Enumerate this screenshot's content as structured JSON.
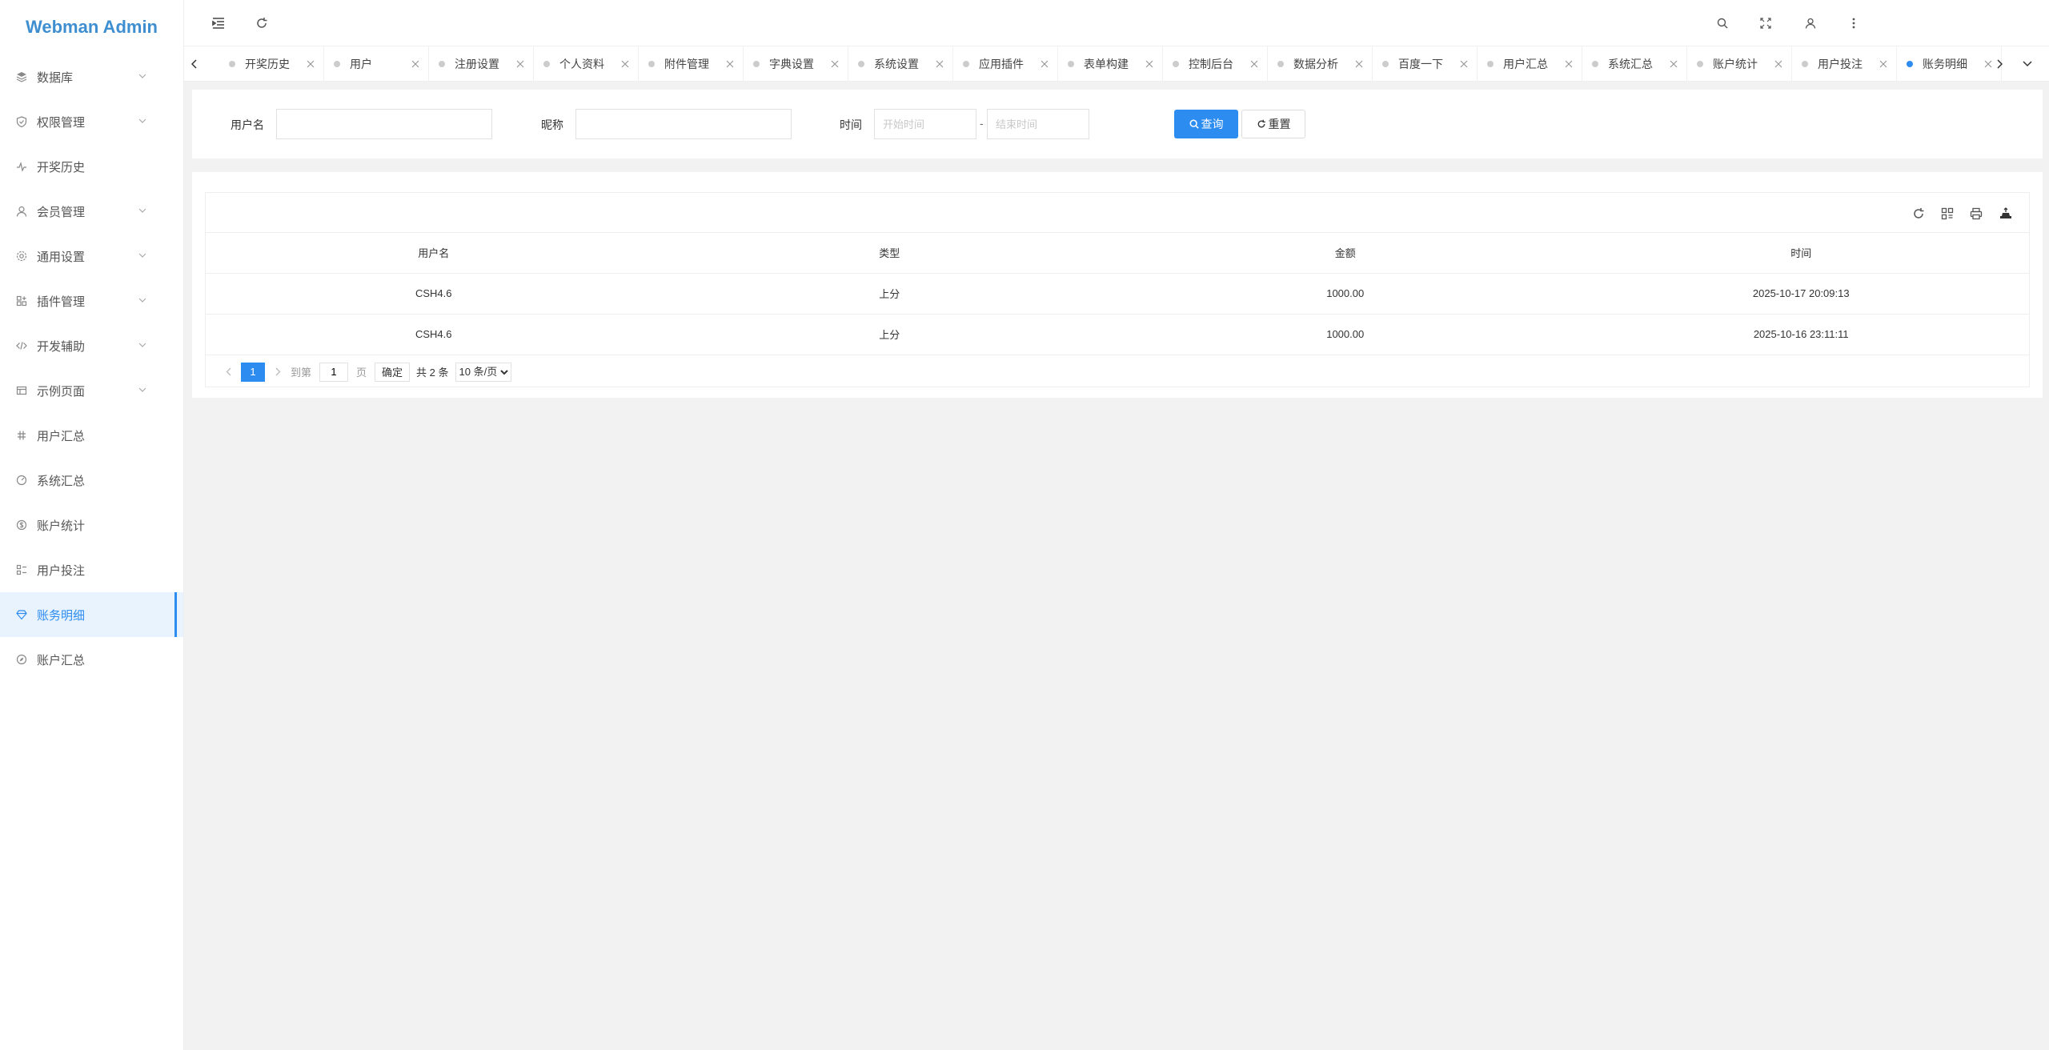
{
  "app": {
    "title": "Webman Admin"
  },
  "sidebar": {
    "items": [
      {
        "label": "数据库",
        "icon": "layers-icon",
        "has_children": true,
        "active": false
      },
      {
        "label": "权限管理",
        "icon": "shield-icon",
        "has_children": true,
        "active": false
      },
      {
        "label": "开奖历史",
        "icon": "pulse-icon",
        "has_children": false,
        "active": false
      },
      {
        "label": "会员管理",
        "icon": "user-icon",
        "has_children": true,
        "active": false
      },
      {
        "label": "通用设置",
        "icon": "gear-icon",
        "has_children": true,
        "active": false
      },
      {
        "label": "插件管理",
        "icon": "plugin-icon",
        "has_children": true,
        "active": false
      },
      {
        "label": "开发辅助",
        "icon": "code-icon",
        "has_children": true,
        "active": false
      },
      {
        "label": "示例页面",
        "icon": "template-icon",
        "has_children": true,
        "active": false
      },
      {
        "label": "用户汇总",
        "icon": "link-icon",
        "has_children": false,
        "active": false
      },
      {
        "label": "系统汇总",
        "icon": "dashboard-icon",
        "has_children": false,
        "active": false
      },
      {
        "label": "账户统计",
        "icon": "dollar-icon",
        "has_children": false,
        "active": false
      },
      {
        "label": "用户投注",
        "icon": "form-icon",
        "has_children": false,
        "active": false
      },
      {
        "label": "账务明细",
        "icon": "diamond-icon",
        "has_children": false,
        "active": true
      },
      {
        "label": "账户汇总",
        "icon": "compass-icon",
        "has_children": false,
        "active": false
      }
    ]
  },
  "tabs": [
    {
      "label": "开奖历史",
      "active": false
    },
    {
      "label": "用户",
      "active": false
    },
    {
      "label": "注册设置",
      "active": false
    },
    {
      "label": "个人资料",
      "active": false
    },
    {
      "label": "附件管理",
      "active": false
    },
    {
      "label": "字典设置",
      "active": false
    },
    {
      "label": "系统设置",
      "active": false
    },
    {
      "label": "应用插件",
      "active": false
    },
    {
      "label": "表单构建",
      "active": false
    },
    {
      "label": "控制后台",
      "active": false
    },
    {
      "label": "数据分析",
      "active": false
    },
    {
      "label": "百度一下",
      "active": false
    },
    {
      "label": "用户汇总",
      "active": false
    },
    {
      "label": "系统汇总",
      "active": false
    },
    {
      "label": "账户统计",
      "active": false
    },
    {
      "label": "用户投注",
      "active": false
    },
    {
      "label": "账务明细",
      "active": true
    }
  ],
  "search": {
    "username_label": "用户名",
    "username_value": "",
    "nickname_label": "昵称",
    "nickname_value": "",
    "time_label": "时间",
    "start_placeholder": "开始时间",
    "end_placeholder": "结束时间",
    "separator": "-",
    "query_label": "查询",
    "reset_label": "重置"
  },
  "table": {
    "columns": [
      "用户名",
      "类型",
      "金额",
      "时间"
    ],
    "rows": [
      [
        "CSH4.6",
        "上分",
        "1000.00",
        "2025-10-17 20:09:13"
      ],
      [
        "CSH4.6",
        "上分",
        "1000.00",
        "2025-10-16 23:11:11"
      ]
    ]
  },
  "pagination": {
    "current_page": "1",
    "goto_label": "到第",
    "goto_value": "1",
    "page_unit": "页",
    "confirm_label": "确定",
    "total_text": "共 2 条",
    "page_size": "10 条/页"
  },
  "colors": {
    "accent": "#2d8cf0",
    "logo": "#3e8ed0"
  }
}
